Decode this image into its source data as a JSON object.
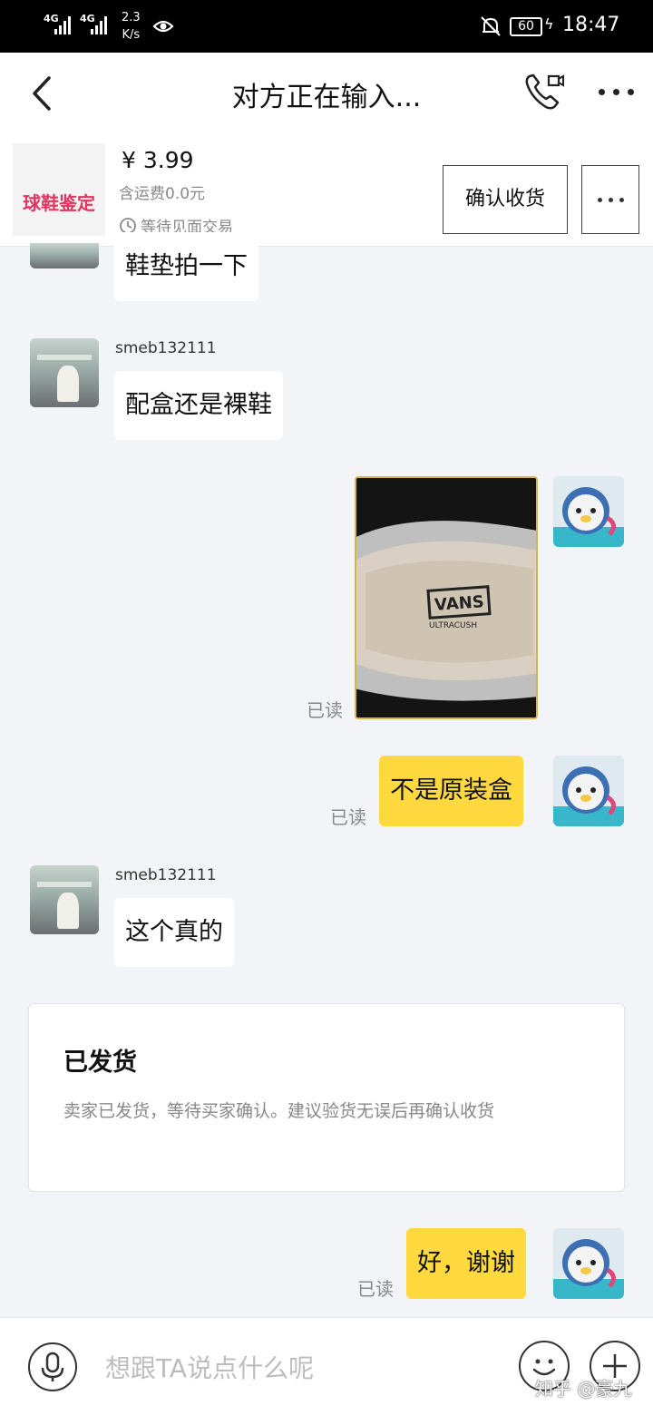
{
  "status_bar": {
    "signal_1": "4G",
    "signal_2": "4G",
    "net_speed_value": "2.3",
    "net_speed_unit": "K/s",
    "battery": "60",
    "time": "18:47"
  },
  "header": {
    "title": "对方正在输入..."
  },
  "order": {
    "thumbnail_text": "球鞋鉴定",
    "price": "¥ 3.99",
    "shipping": "含运费0.0元",
    "status": "等待见面交易",
    "confirm_button": "确认收货"
  },
  "messages": [
    {
      "from": "peer",
      "text": "鞋垫拍一下"
    },
    {
      "from": "peer",
      "username": "smeb132111",
      "text": "配盒还是裸鞋"
    },
    {
      "from": "me",
      "type": "image",
      "read": "已读"
    },
    {
      "from": "me",
      "text": "不是原装盒",
      "read": "已读"
    },
    {
      "from": "peer",
      "username": "smeb132111",
      "text": "这个真的"
    },
    {
      "from": "me",
      "text": "好，谢谢",
      "read": "已读"
    }
  ],
  "notice": {
    "title": "已发货",
    "body": "卖家已发货，等待买家确认。建议验货无误后再确认收货"
  },
  "input": {
    "placeholder": "想跟TA说点什么呢"
  },
  "watermark": "知乎 @豪九"
}
